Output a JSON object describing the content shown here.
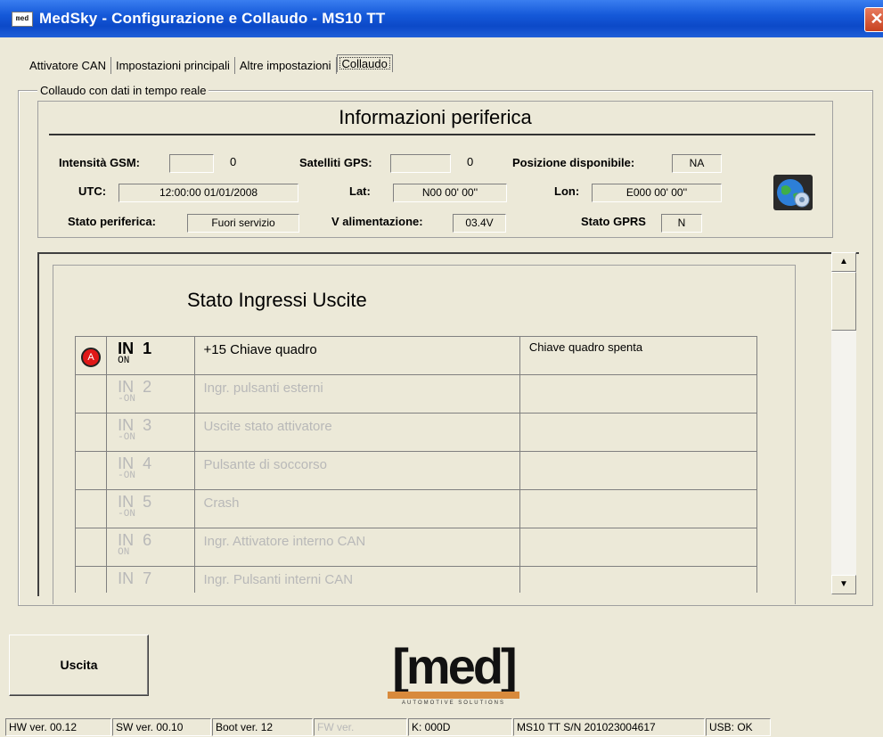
{
  "window": {
    "title": "MedSky - Configurazione e Collaudo - MS10 TT",
    "app_icon_text": "med",
    "close_symbol": "✕"
  },
  "tabs": [
    {
      "label": "Attivatore CAN"
    },
    {
      "label": "Impostazioni principali"
    },
    {
      "label": "Altre impostazioni"
    },
    {
      "label": "Collaudo",
      "active": true
    }
  ],
  "group": {
    "label": "Collaudo con dati in tempo reale"
  },
  "info": {
    "title": "Informazioni periferica",
    "gsm_label": "Intensità GSM:",
    "gsm_value": "0",
    "sat_label": "Satelliti GPS:",
    "sat_value": "0",
    "pos_label": "Posizione disponibile:",
    "pos_value": "NA",
    "utc_label": "UTC:",
    "utc_value": "12:00:00 01/01/2008",
    "lat_label": "Lat:",
    "lat_value": "N00 00' 00''",
    "lon_label": "Lon:",
    "lon_value": "E000 00' 00''",
    "stato_label": "Stato periferica:",
    "stato_value": "Fuori servizio",
    "valim_label": "V alimentazione:",
    "valim_value": "03.4V",
    "gprs_label": "Stato GPRS",
    "gprs_value": "N"
  },
  "io": {
    "title": "Stato Ingressi Uscite",
    "rows": [
      {
        "in": "IN",
        "num": "1",
        "sub": "ON",
        "desc": "+15 Chiave quadro",
        "state": "Chiave quadro spenta",
        "badge": "A",
        "active": true
      },
      {
        "in": "IN",
        "num": "2",
        "sub": "-ON",
        "desc": "Ingr. pulsanti esterni",
        "state": "",
        "badge": "",
        "active": false
      },
      {
        "in": "IN",
        "num": "3",
        "sub": "-ON",
        "desc": "Uscite stato attivatore",
        "state": "",
        "badge": "",
        "active": false
      },
      {
        "in": "IN",
        "num": "4",
        "sub": "-ON",
        "desc": "Pulsante di soccorso",
        "state": "",
        "badge": "",
        "active": false
      },
      {
        "in": "IN",
        "num": "5",
        "sub": "-ON",
        "desc": "Crash",
        "state": "",
        "badge": "",
        "active": false
      },
      {
        "in": "IN",
        "num": "6",
        "sub": "ON",
        "desc": "Ingr. Attivatore interno CAN",
        "state": "",
        "badge": "",
        "active": false
      },
      {
        "in": "IN",
        "num": "7",
        "sub": "",
        "desc": "Ingr. Pulsanti interni CAN",
        "state": "",
        "badge": "",
        "active": false
      }
    ]
  },
  "scrollbar": {
    "up": "▲",
    "down": "▼"
  },
  "footer": {
    "exit_label": "Uscita",
    "logo_text": "[med]",
    "logo_tagline": "AUTOMOTIVE SOLUTIONS"
  },
  "status": {
    "hw": "HW ver. 00.12",
    "sw": "SW ver. 00.10",
    "boot": "Boot ver. 12",
    "fw": "FW ver.",
    "k": "K: 000D",
    "sn": "MS10 TT S/N 201023004617",
    "usb": "USB: OK"
  },
  "colors": {
    "titlebar": "#0c49c8",
    "badge": "#e01818",
    "logo_accent": "#d88a3c",
    "window_bg": "#ece9d8"
  }
}
